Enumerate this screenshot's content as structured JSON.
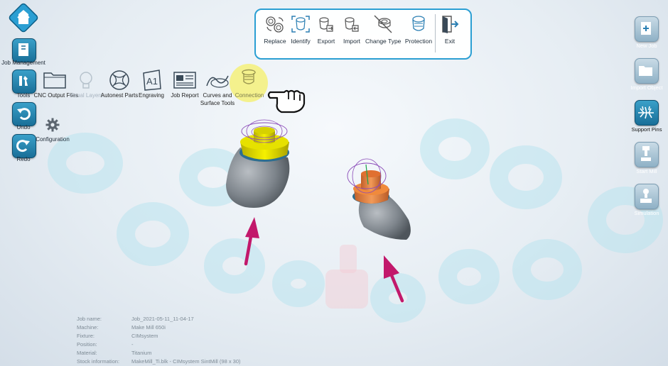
{
  "left_panel": {
    "job_management": "Job Management",
    "tools": "Tools",
    "undo": "Undo",
    "redo": "Redo",
    "configuration": "Configuration"
  },
  "ribbon": {
    "cnc_output": "CNC Output Files",
    "visual_layers": "Visual Layers",
    "autonest": "Autonest Parts",
    "engraving": "Engraving",
    "job_report": "Job Report",
    "curves": "Curves and Surface Tools",
    "connection": "Connection",
    "engraving_glyph": "A1"
  },
  "toolbar": {
    "replace": "Replace",
    "identify": "Identify",
    "export": "Export",
    "import": "Import",
    "change_type": "Change Type",
    "protection": "Protection",
    "exit": "Exit"
  },
  "right_panel": {
    "new_job": "New Job",
    "import_object": "Import Object",
    "support_pins": "Support Pins",
    "start_mill": "Start Mill",
    "simulation": "Simulation"
  },
  "job_info": [
    {
      "key": "Job name:",
      "value": "Job_2021-05-11_11-04-17"
    },
    {
      "key": "Machine:",
      "value": "Make Mill 650i"
    },
    {
      "key": "Fixture:",
      "value": "CIMsystem"
    },
    {
      "key": "Position:",
      "value": "-"
    },
    {
      "key": "Material:",
      "value": "Titanium"
    },
    {
      "key": "Stock information:",
      "value": "MakeMill_Ti.blk - CIMsystem SintMill (98 x 30)"
    }
  ],
  "colors": {
    "accent": "#2b9fd3",
    "highlight": "#f4f07a",
    "part_yellow": "#e8e300",
    "part_orange": "#f08a3c",
    "pin_magenta": "#c2186b"
  }
}
